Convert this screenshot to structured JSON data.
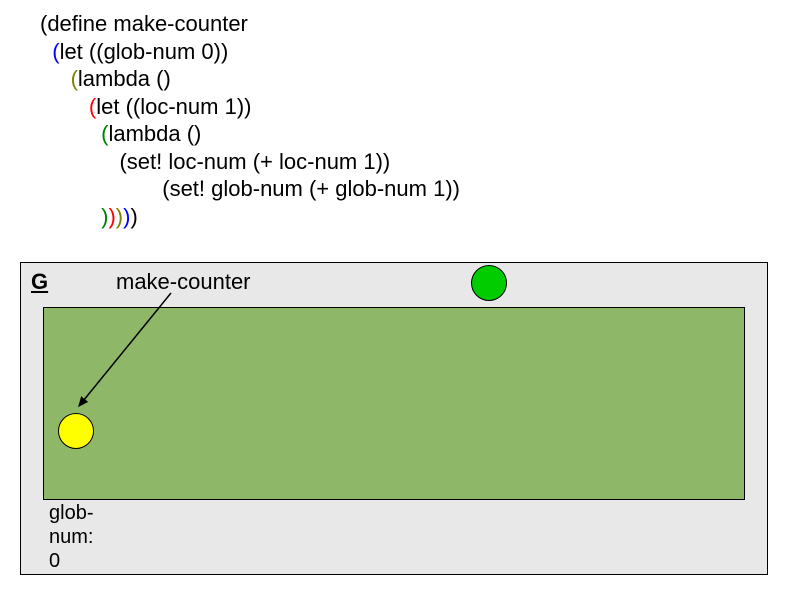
{
  "code": {
    "l1_a": "(define make-counter",
    "l2_a": "  ",
    "l2_b": "(",
    "l2_c": "let ((glob-num 0))",
    "l3_a": "     ",
    "l3_b": "(",
    "l3_c": "lambda ()",
    "l4_a": "        ",
    "l4_b": "(",
    "l4_c": "let ((loc-num 1))",
    "l5_a": "          ",
    "l5_b": "(",
    "l5_c": "lambda ()",
    "l6_a": "             (set! loc-num (+ loc-num 1))",
    "l7_a": "                    (set! glob-num (+ glob-num 1))",
    "l8_a": "          ",
    "l8_b": ")",
    "l8_c": ")",
    "l8_d": ")",
    "l8_e": ")",
    "l8_f": ")"
  },
  "diagram": {
    "g_label": "G",
    "make_counter": "make-counter",
    "globnum_l1": "glob-",
    "globnum_l2": "num:",
    "globnum_l3": "0"
  }
}
